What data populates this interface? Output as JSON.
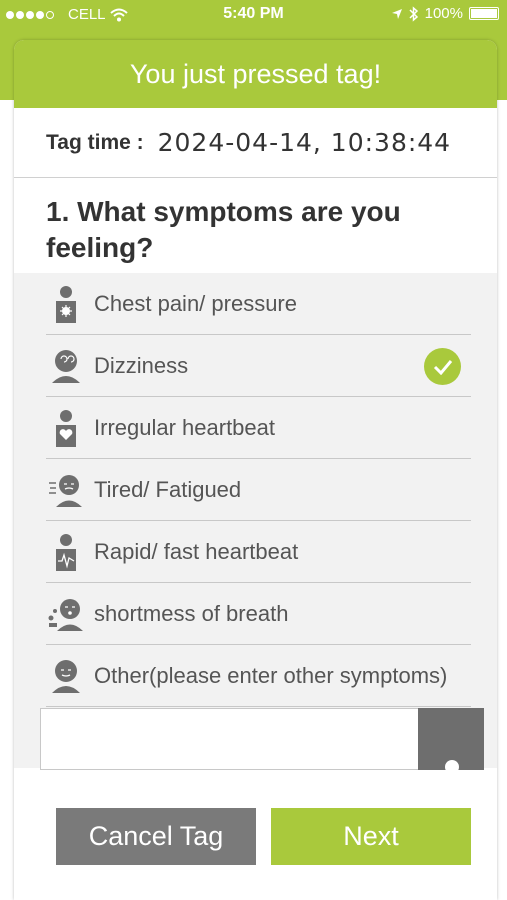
{
  "status_bar": {
    "carrier": "CELL",
    "time": "5:40 PM",
    "battery": "100%"
  },
  "header": {
    "title": "You just pressed tag!"
  },
  "tag_time": {
    "label": "Tag time :",
    "value": "2024-04-14, 10:38:44"
  },
  "question": {
    "text": "1. What symptoms are you feeling?"
  },
  "symptoms": [
    {
      "label": "Chest pain/ pressure",
      "icon": "chest-pain-icon",
      "selected": false
    },
    {
      "label": "Dizziness",
      "icon": "dizziness-icon",
      "selected": true
    },
    {
      "label": "Irregular heartbeat",
      "icon": "irregular-heartbeat-icon",
      "selected": false
    },
    {
      "label": "Tired/ Fatigued",
      "icon": "tired-icon",
      "selected": false
    },
    {
      "label": "Rapid/ fast heartbeat",
      "icon": "rapid-heartbeat-icon",
      "selected": false
    },
    {
      "label": "shortmess of breath",
      "icon": "shortness-of-breath-icon",
      "selected": false
    },
    {
      "label": "Other(please enter other symptoms)",
      "icon": "other-symptom-icon",
      "selected": false
    }
  ],
  "other_input": {
    "value": "",
    "placeholder": ""
  },
  "buttons": {
    "cancel": "Cancel Tag",
    "next": "Next"
  },
  "colors": {
    "accent": "#a9c93c",
    "cancel": "#7a7a7a",
    "icon": "#6e6e6e"
  }
}
